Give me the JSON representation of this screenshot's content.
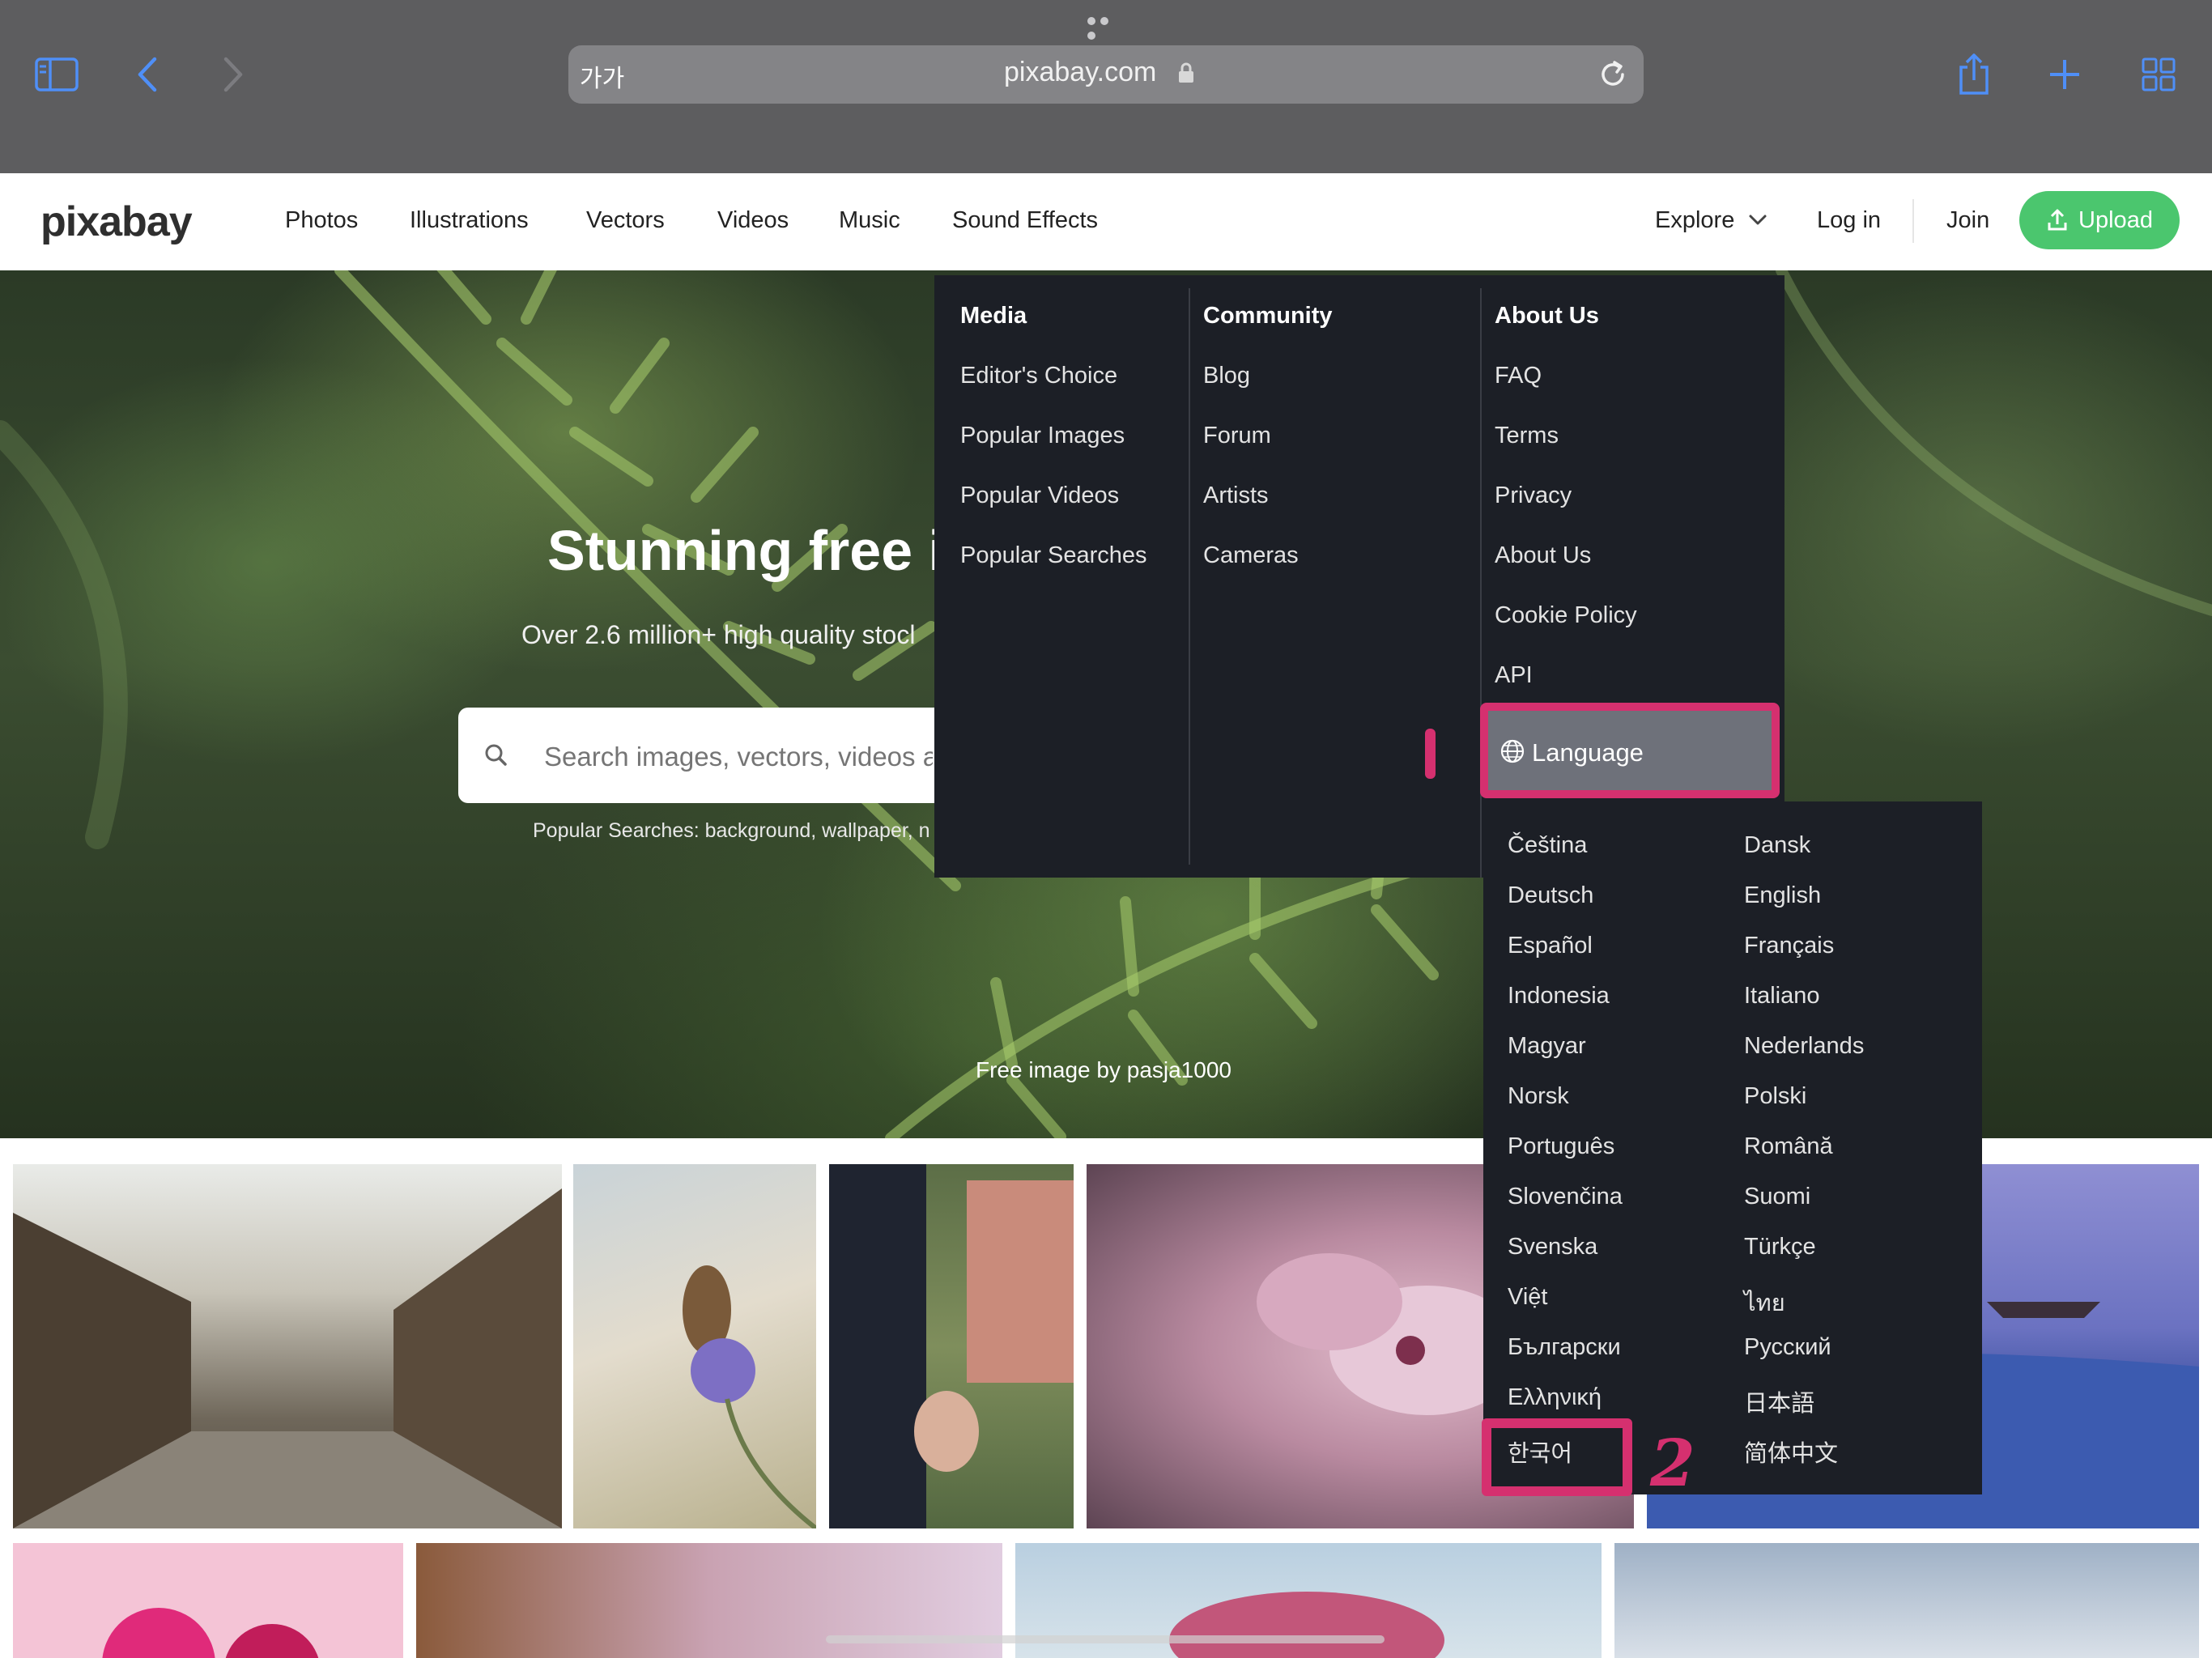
{
  "browser": {
    "aa_label": "가가",
    "url": "pixabay.com",
    "icons": [
      "sidebar-icon",
      "back-icon",
      "forward-icon",
      "lock-icon",
      "reload-icon",
      "share-icon",
      "new-tab-icon",
      "tabs-icon"
    ]
  },
  "nav": {
    "logo": "pixabay",
    "links": [
      "Photos",
      "Illustrations",
      "Vectors",
      "Videos",
      "Music",
      "Sound Effects"
    ],
    "explore": "Explore",
    "login": "Log in",
    "join": "Join",
    "upload": "Upload",
    "upload_color": "#4bc66e"
  },
  "hero": {
    "title": "Stunning free i",
    "subtitle": "Over 2.6 million+ high quality stocl",
    "search_placeholder": "Search images, vectors, videos a",
    "popular": "Popular Searches: background, wallpaper, n",
    "credit": "Free image by pasja1000"
  },
  "menu": {
    "columns": [
      {
        "heading": "Media",
        "items": [
          "Editor's Choice",
          "Popular Images",
          "Popular Videos",
          "Popular Searches"
        ]
      },
      {
        "heading": "Community",
        "items": [
          "Blog",
          "Forum",
          "Artists",
          "Cameras"
        ]
      },
      {
        "heading": "About Us",
        "items": [
          "FAQ",
          "Terms",
          "Privacy",
          "About Us",
          "Cookie Policy",
          "API"
        ]
      }
    ],
    "language": "Language",
    "highlight_color": "#d5306f"
  },
  "languages": {
    "left": [
      "Čeština",
      "Deutsch",
      "Español",
      "Indonesia",
      "Magyar",
      "Norsk",
      "Português",
      "Slovenčina",
      "Svenska",
      "Việt",
      "Български",
      "Ελληνική",
      "한국어"
    ],
    "right": [
      "Dansk",
      "English",
      "Français",
      "Italiano",
      "Nederlands",
      "Polski",
      "Română",
      "Suomi",
      "Türkçe",
      "ไทย",
      "Русский",
      "日本語",
      "简体中文"
    ]
  },
  "annotations": {
    "step1": "1",
    "step2": "2"
  }
}
